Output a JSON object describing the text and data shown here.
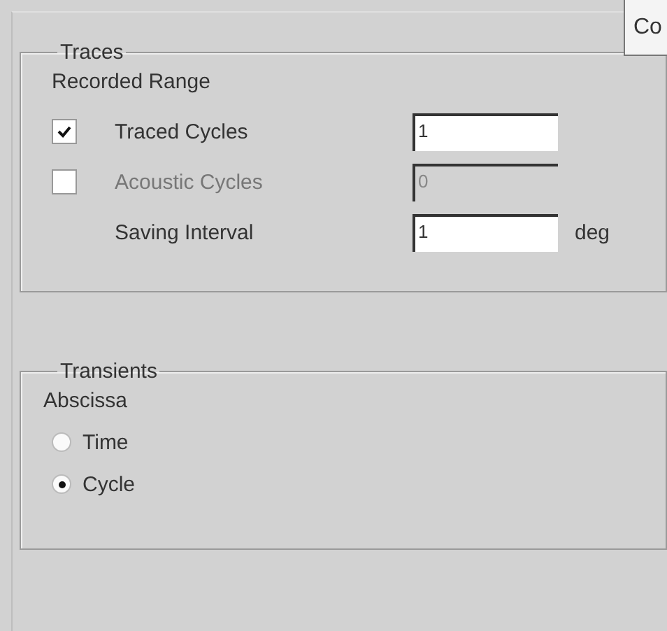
{
  "corner_button": {
    "label": "Co"
  },
  "traces": {
    "title": "Traces",
    "subtitle": "Recorded Range",
    "rows": [
      {
        "kind": "checkbox",
        "label": "Traced Cycles",
        "checked": true,
        "value": "1",
        "disabled": false
      },
      {
        "kind": "checkbox",
        "label": "Acoustic Cycles",
        "checked": false,
        "value": "0",
        "disabled": true
      },
      {
        "kind": "plain",
        "label": "Saving Interval",
        "value": "1",
        "unit": "deg",
        "disabled": false
      }
    ]
  },
  "transients": {
    "title": "Transients",
    "subtitle": "Abscissa",
    "options": [
      {
        "label": "Time",
        "selected": false
      },
      {
        "label": "Cycle",
        "selected": true
      }
    ]
  }
}
